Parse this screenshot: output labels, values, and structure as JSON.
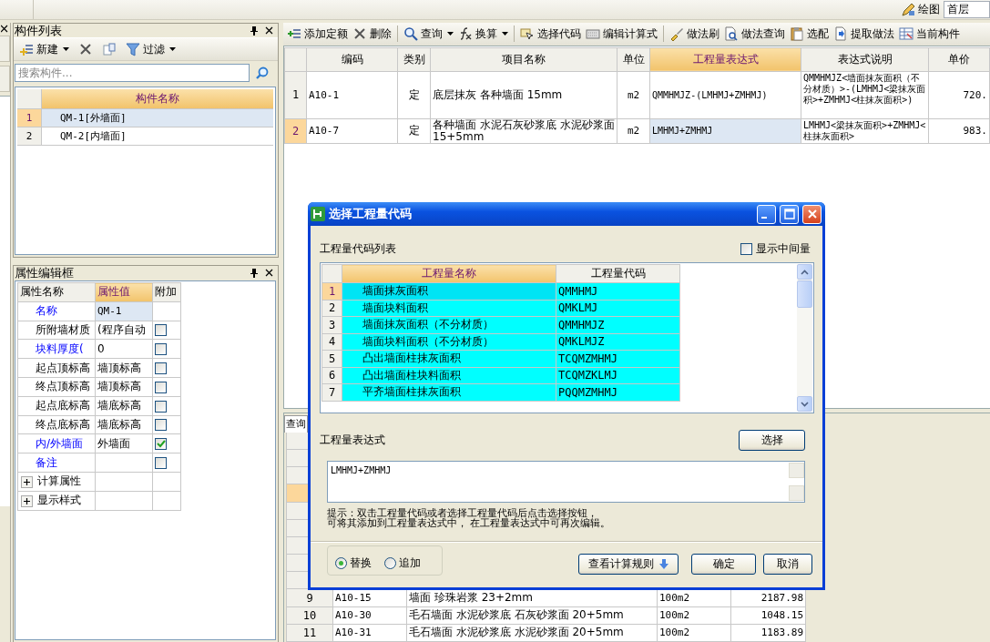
{
  "top_bar": {
    "view_button": "绘图",
    "floor_field": "首层"
  },
  "component_panel": {
    "title": "构件列表",
    "toolbar": [
      {
        "kind": "new",
        "label": "新建",
        "dropdown": true
      },
      {
        "kind": "delete",
        "dropdown": false
      },
      {
        "kind": "copy",
        "dropdown": false
      },
      {
        "kind": "filter",
        "label": "过滤",
        "dropdown": true
      }
    ],
    "search": {
      "placeholder": "搜索构件..."
    },
    "column": "构件名称",
    "rows": [
      {
        "index": "1",
        "name": "QM-1[外墙面]",
        "selected": true
      },
      {
        "index": "2",
        "name": "QM-2[内墙面]",
        "selected": false
      }
    ]
  },
  "property_panel": {
    "title": "属性编辑框",
    "columns": [
      "属性名称",
      "属性值",
      "附加"
    ],
    "rows": [
      {
        "kind": "text",
        "name": "名称",
        "value": "QM-1",
        "emphasized": true,
        "selected": true
      },
      {
        "kind": "check",
        "name": "所附墙材质",
        "value": "(程序自动",
        "emphasized": false,
        "checked": false,
        "selected": false
      },
      {
        "kind": "check",
        "name": "块料厚度(",
        "value": "0",
        "emphasized": true,
        "checked": false,
        "selected": false
      },
      {
        "kind": "check",
        "name": "起点顶标高",
        "value": "墙顶标高",
        "emphasized": false,
        "checked": false,
        "selected": false
      },
      {
        "kind": "check",
        "name": "终点顶标高",
        "value": "墙顶标高",
        "emphasized": false,
        "checked": false,
        "selected": false
      },
      {
        "kind": "check",
        "name": "起点底标高",
        "value": "墙底标高",
        "emphasized": false,
        "checked": false,
        "selected": false
      },
      {
        "kind": "check",
        "name": "终点底标高",
        "value": "墙底标高",
        "emphasized": false,
        "checked": false,
        "selected": false
      },
      {
        "kind": "check",
        "name": "内/外墙面",
        "value": "外墙面",
        "emphasized": true,
        "checked": true,
        "selected": false
      },
      {
        "kind": "check",
        "name": "备注",
        "emphasized": true,
        "checked": false,
        "selected": false
      },
      {
        "kind": "group",
        "name": "计算属性",
        "expanded": false
      },
      {
        "kind": "group",
        "name": "显示样式",
        "expanded": false
      }
    ]
  },
  "main_toolbar": [
    {
      "kind": "add",
      "label": "添加定额",
      "dropdown": false,
      "separator": false
    },
    {
      "kind": "delete",
      "label": "删除",
      "dropdown": false,
      "separator": true
    },
    {
      "kind": "search",
      "label": "查询",
      "dropdown": true,
      "separator": false
    },
    {
      "kind": "function",
      "label": "换算",
      "dropdown": true,
      "separator": true
    },
    {
      "kind": "pointer",
      "label": "选择代码",
      "dropdown": false,
      "separator": false
    },
    {
      "kind": "keyboard",
      "label": "编辑计算式",
      "dropdown": false,
      "separator": true
    },
    {
      "kind": "brush",
      "label": "做法刷",
      "dropdown": false,
      "separator": false
    },
    {
      "kind": "doc-search",
      "label": "做法查询",
      "dropdown": false,
      "separator": false
    },
    {
      "kind": "clipboard",
      "label": "选配",
      "dropdown": false,
      "separator": false
    },
    {
      "kind": "extract",
      "label": "提取做法",
      "dropdown": false,
      "separator": false
    },
    {
      "kind": "table",
      "label": "当前构件",
      "dropdown": false,
      "separator": false
    }
  ],
  "quota_table": {
    "columns": [
      {
        "label": "编码",
        "active": false
      },
      {
        "label": "类别",
        "active": false
      },
      {
        "label": "项目名称",
        "active": false
      },
      {
        "label": "单位",
        "active": false
      },
      {
        "label": "工程量表达式",
        "active": true
      },
      {
        "label": "表达式说明",
        "active": false
      },
      {
        "label": "单价",
        "active": false
      }
    ],
    "rows": [
      {
        "index": "1",
        "code": "A10-1",
        "type": "定",
        "name": "底层抹灰 各种墙面 15mm",
        "unit": "m2",
        "expression": "QMMHMJZ-(LMHMJ+ZMHMJ)",
        "description": "QMMHMJZ<墙面抹灰面积（不分材质）>-(LMHMJ<梁抹灰面积>+ZMHMJ<柱抹灰面积>)",
        "price": "720.",
        "selected": false
      },
      {
        "index": "2",
        "code": "A10-7",
        "type": "定",
        "name": "各种墙面 水泥石灰砂浆底 水泥砂浆面 15+5mm",
        "unit": "m2",
        "expression": "LMHMJ+ZMHMJ",
        "description": "LMHMJ<梁抹灰面积>+ZMHMJ<柱抹灰面积>",
        "price": "983.",
        "selected": true
      }
    ]
  },
  "query_panel": {
    "tab": "查询",
    "covered_rows": [
      {
        "selected": false
      },
      {
        "selected": false
      },
      {
        "selected": true
      },
      {
        "selected": false
      },
      {
        "selected": false
      },
      {
        "selected": false
      },
      {
        "selected": false
      },
      {
        "selected": false
      }
    ],
    "rows": [
      {
        "index": "9",
        "code": "A10-15",
        "name": "墙面 珍珠岩浆 23+2mm",
        "unit": "100m2",
        "price": "2187.98"
      },
      {
        "index": "10",
        "code": "A10-30",
        "name": "毛石墙面 水泥砂浆底 石灰砂浆面 20+5mm",
        "unit": "100m2",
        "price": "1048.15"
      },
      {
        "index": "11",
        "code": "A10-31",
        "name": "毛石墙面 水泥砂浆底 水泥砂浆面 20+5mm",
        "unit": "100m2",
        "price": "1183.89"
      }
    ]
  },
  "dialog": {
    "title": "选择工程量代码",
    "list_label": "工程量代码列表",
    "show_intermediate": {
      "label": "显示中间量",
      "checked": false
    },
    "columns": [
      {
        "label": "工程量名称",
        "active": true
      },
      {
        "label": "工程量代码",
        "active": false
      }
    ],
    "rows": [
      {
        "index": "1",
        "name": "墙面抹灰面积",
        "code": "QMMHMJ",
        "selected": true
      },
      {
        "index": "2",
        "name": "墙面块料面积",
        "code": "QMKLMJ",
        "selected": false
      },
      {
        "index": "3",
        "name": "墙面抹灰面积（不分材质）",
        "code": "QMMHMJZ",
        "selected": false
      },
      {
        "index": "4",
        "name": "墙面块料面积（不分材质）",
        "code": "QMKLMJZ",
        "selected": false
      },
      {
        "index": "5",
        "name": "凸出墙面柱抹灰面积",
        "code": "TCQMZMHMJ",
        "selected": false
      },
      {
        "index": "6",
        "name": "凸出墙面柱块料面积",
        "code": "TCQMZKLMJ",
        "selected": false
      },
      {
        "index": "7",
        "name": "平齐墙面柱抹灰面积",
        "code": "PQQMZMHMJ",
        "selected": false
      }
    ],
    "expression_label": "工程量表达式",
    "select_button": "选择",
    "expression": "LMHMJ+ZMHMJ",
    "hint_lines": [
      "提示：双击工程量代码或者选择工程量代码后点击选择按钮，",
      "可将其添加到工程量表达式中， 在工程量表达式中可再次编辑。"
    ],
    "modes": [
      {
        "label": "替换",
        "selected": true
      },
      {
        "label": "追加",
        "selected": false
      }
    ],
    "rules_button": "查看计算规则",
    "ok_button": "确定",
    "cancel_button": "取消"
  }
}
